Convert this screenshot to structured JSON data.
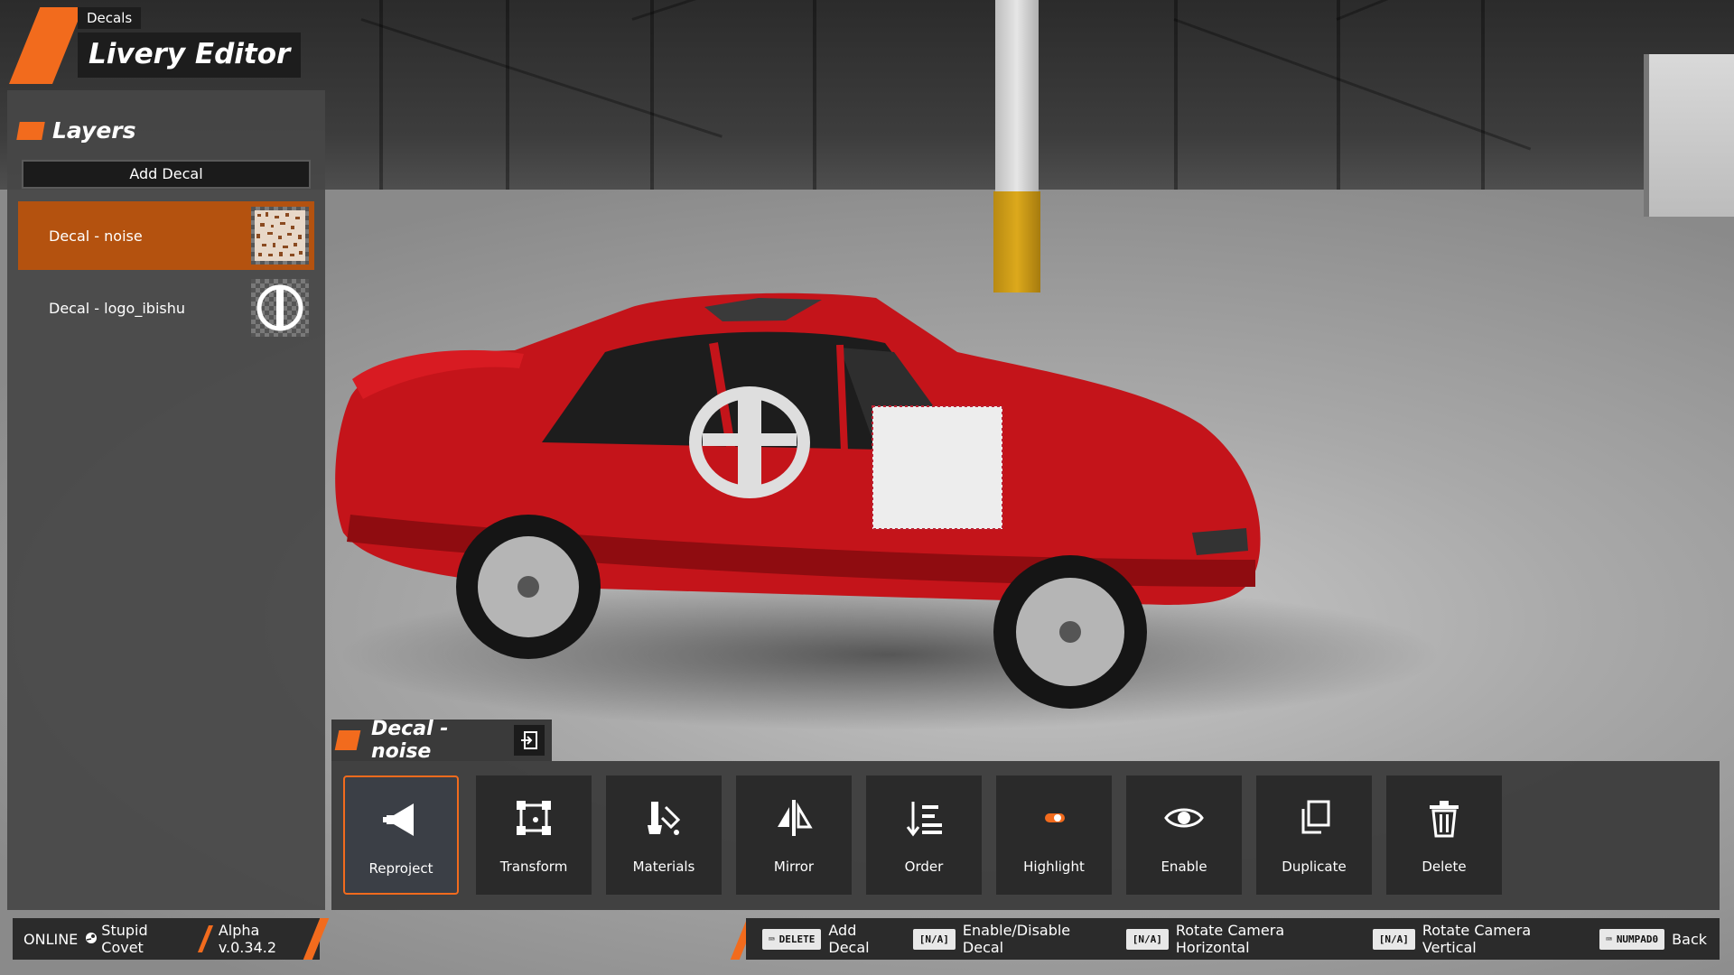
{
  "header": {
    "breadcrumb": "Decals",
    "title": "Livery Editor"
  },
  "layers": {
    "title": "Layers",
    "add_decal_label": "Add Decal",
    "items": [
      {
        "label": "Decal - noise",
        "selected": true,
        "thumb": "noise-texture-icon"
      },
      {
        "label": "Decal - logo_ibishu",
        "selected": false,
        "thumb": "ibishu-logo-icon"
      }
    ]
  },
  "decal_panel": {
    "title": "Decal - noise",
    "tools": [
      {
        "label": "Reproject",
        "icon": "reproject-icon",
        "active": true
      },
      {
        "label": "Transform",
        "icon": "transform-icon",
        "active": false
      },
      {
        "label": "Materials",
        "icon": "materials-icon",
        "active": false
      },
      {
        "label": "Mirror",
        "icon": "mirror-icon",
        "active": false
      },
      {
        "label": "Order",
        "icon": "order-icon",
        "active": false
      },
      {
        "label": "Highlight",
        "icon": "highlight-toggle-icon",
        "active": false
      },
      {
        "label": "Enable",
        "icon": "eye-icon",
        "active": false
      },
      {
        "label": "Duplicate",
        "icon": "duplicate-icon",
        "active": false
      },
      {
        "label": "Delete",
        "icon": "trash-icon",
        "active": false
      }
    ]
  },
  "status": {
    "online": "ONLINE",
    "user": "Stupid Covet",
    "version": "Alpha v.0.34.2"
  },
  "hints": [
    {
      "key": "DELETE",
      "has_kb_icon": true,
      "action": "Add Decal"
    },
    {
      "key": "[N/A]",
      "has_kb_icon": false,
      "action": "Enable/Disable Decal"
    },
    {
      "key": "[N/A]",
      "has_kb_icon": false,
      "action": "Rotate Camera Horizontal"
    },
    {
      "key": "[N/A]",
      "has_kb_icon": false,
      "action": "Rotate Camera Vertical"
    },
    {
      "key": "NUMPAD0",
      "has_kb_icon": true,
      "action": "Back"
    }
  ],
  "colors": {
    "accent": "#f26b1d",
    "selected_row": "#b4520f",
    "car_body": "#c4141a"
  }
}
